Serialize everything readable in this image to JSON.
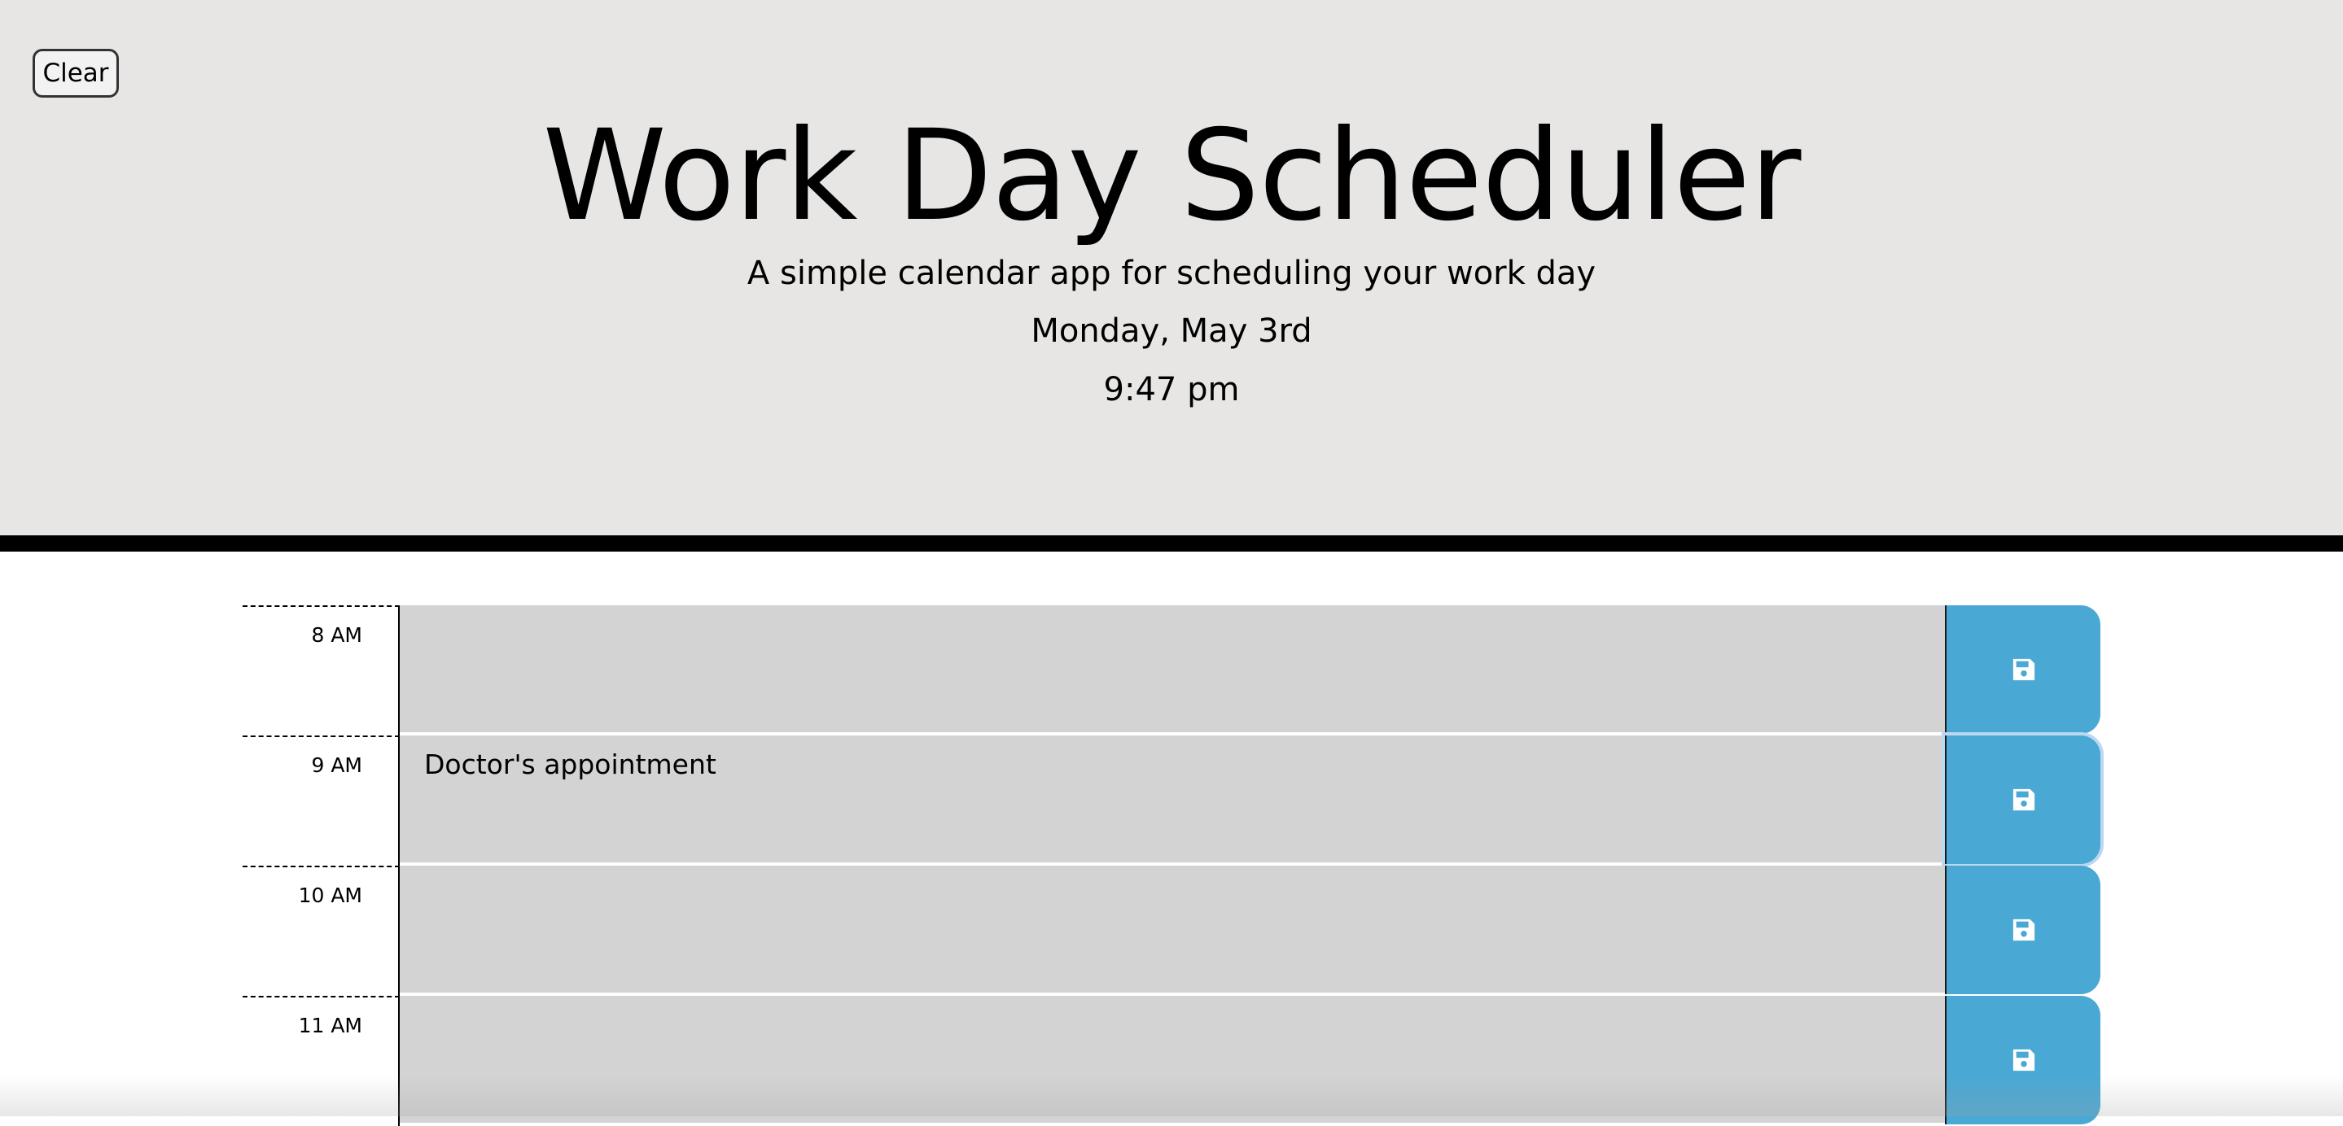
{
  "header": {
    "clear_label": "Clear",
    "title": "Work Day Scheduler",
    "subtitle": "A simple calendar app for scheduling your work day",
    "current_day": "Monday, May 3rd",
    "current_time": "9:47 pm"
  },
  "schedule": {
    "rows": [
      {
        "hour": "8 AM",
        "description": ""
      },
      {
        "hour": "9 AM",
        "description": "Doctor's appointment"
      },
      {
        "hour": "10 AM",
        "description": ""
      },
      {
        "hour": "11 AM",
        "description": ""
      }
    ],
    "save_icon": "floppy-disk-icon"
  },
  "colors": {
    "header_background": "#e7e6e5",
    "past_row": "#d3d3d3",
    "save_button": "#4aa8d4",
    "header_border": "#000000"
  }
}
